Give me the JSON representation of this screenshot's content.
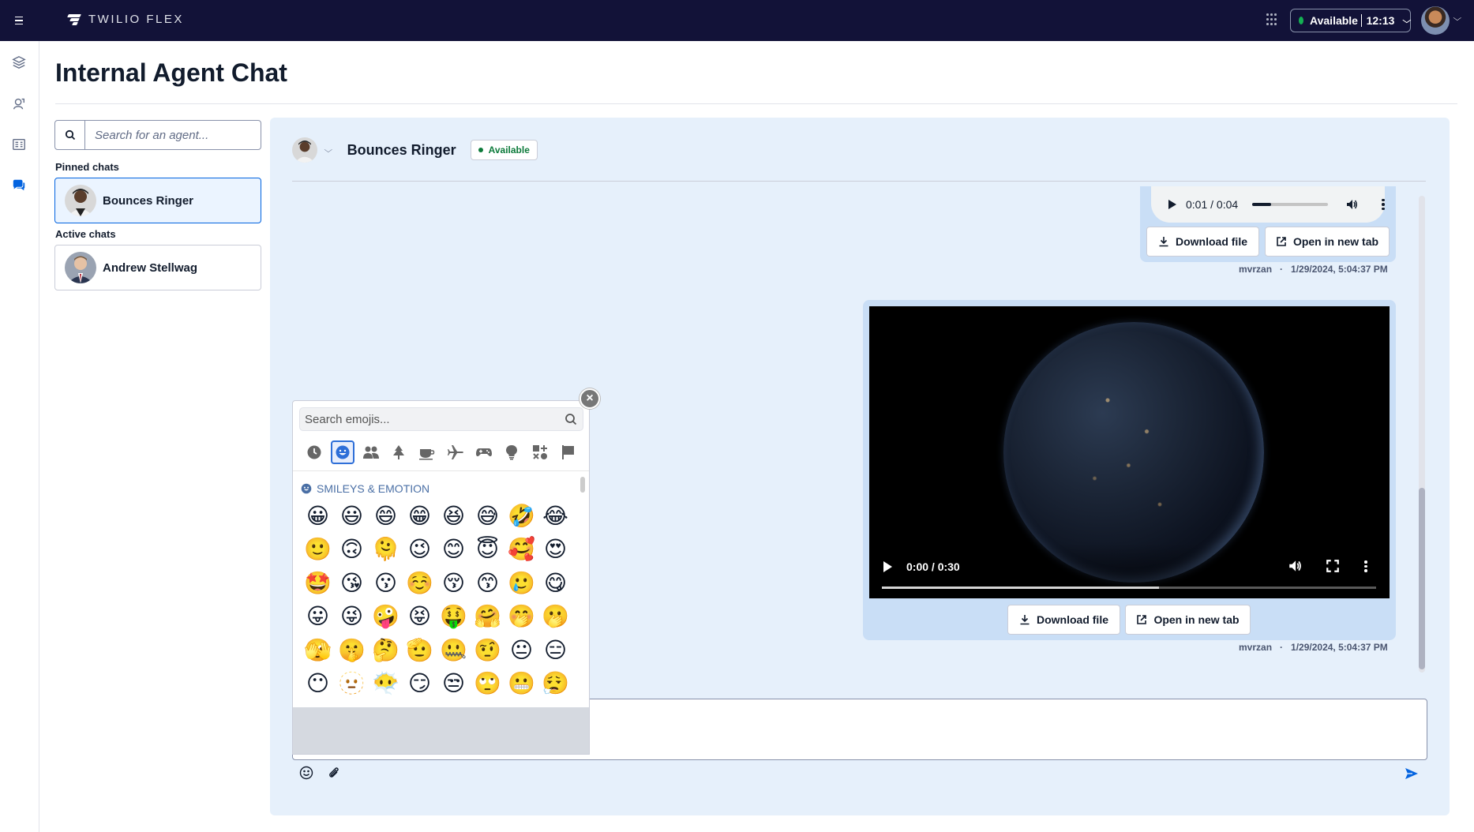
{
  "topbar": {
    "brand": "TWILIO FLEX",
    "status_label": "Available",
    "status_timer": "12:13",
    "status_color": "#14b053"
  },
  "rail": {
    "items": [
      "layers-icon",
      "agent-desktop-icon",
      "queues-stats-icon",
      "chat-icon"
    ]
  },
  "page": {
    "title": "Internal Agent Chat"
  },
  "sidebar": {
    "search_placeholder": "Search for an agent...",
    "pinned_label": "Pinned chats",
    "pinned": [
      {
        "name": "Bounces Ringer"
      }
    ],
    "active_label": "Active chats",
    "active": [
      {
        "name": "Andrew Stellwag"
      }
    ]
  },
  "chat": {
    "contact_name": "Bounces Ringer",
    "contact_status": "Available",
    "messages": [
      {
        "type": "audio",
        "player_time": "0:01 / 0:04",
        "progress": 0.25,
        "download_label": "Download file",
        "open_label": "Open in new tab",
        "author": "mvrzan",
        "timestamp": "1/29/2024, 5:04:37 PM"
      },
      {
        "type": "video",
        "player_time": "0:00 / 0:30",
        "progress": 0.56,
        "download_label": "Download file",
        "open_label": "Open in new tab",
        "author": "mvrzan",
        "timestamp": "1/29/2024, 5:04:37 PM"
      }
    ],
    "composer": {
      "emoji_button": "emoji-icon",
      "attach_button": "paperclip-icon",
      "send_button": "send-icon"
    }
  },
  "emoji_picker": {
    "search_placeholder": "Search emojis...",
    "categories": [
      "recent",
      "smileys",
      "people",
      "nature",
      "food",
      "travel",
      "activities",
      "objects",
      "symbols",
      "flags"
    ],
    "active_category": "smileys",
    "category_title": "SMILEYS & EMOTION",
    "emojis": [
      "😀",
      "😃",
      "😄",
      "😁",
      "😆",
      "😅",
      "🤣",
      "😂",
      "🙂",
      "🙃",
      "🫠",
      "😉",
      "😊",
      "😇",
      "🥰",
      "😍",
      "🤩",
      "😘",
      "😗",
      "☺️",
      "😚",
      "😙",
      "🥲",
      "😋",
      "😛",
      "😜",
      "🤪",
      "😝",
      "🤑",
      "🤗",
      "🤭",
      "🫢",
      "🫣",
      "🤫",
      "🤔",
      "🫡",
      "🤐",
      "🤨",
      "😐",
      "😑",
      "😶",
      "🫥",
      "😶‍🌫️",
      "😏",
      "😒",
      "🙄",
      "😬",
      "😮‍💨"
    ]
  }
}
